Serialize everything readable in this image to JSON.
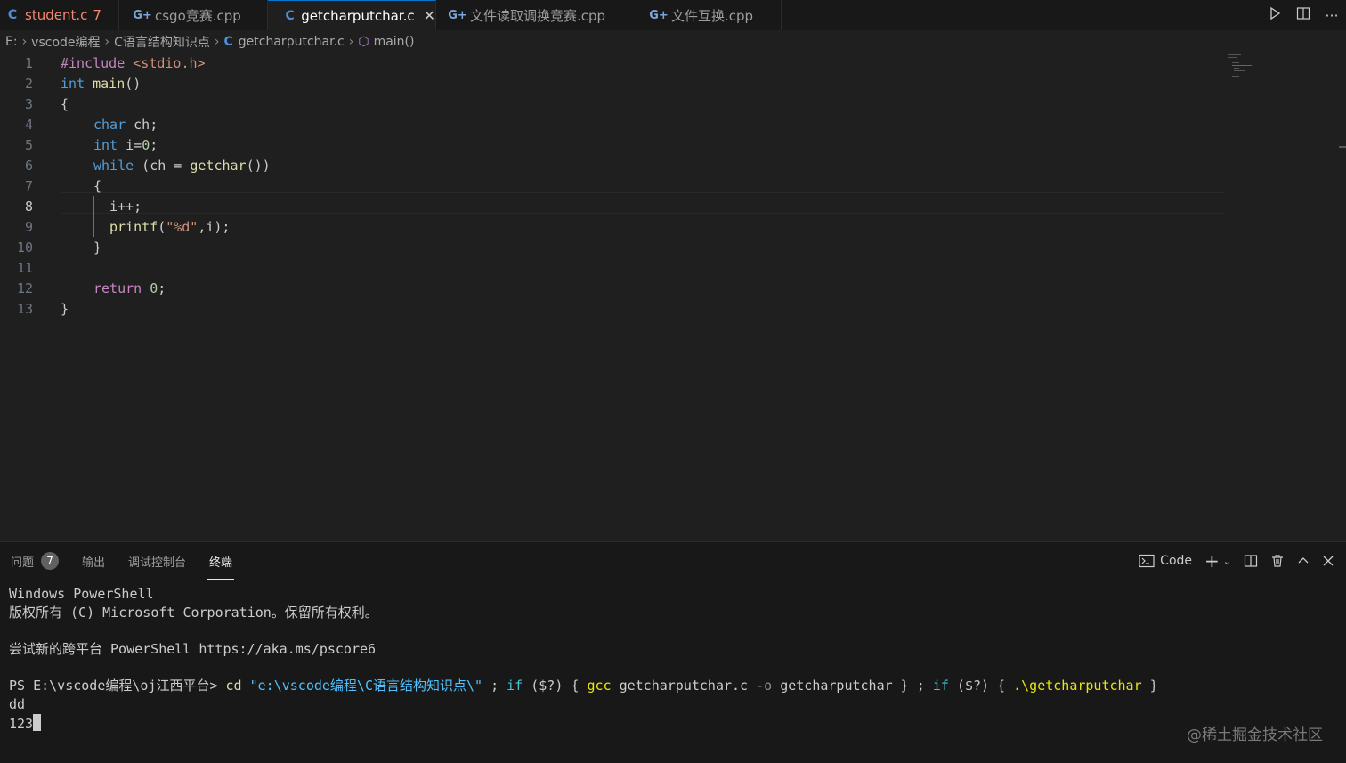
{
  "tabs": [
    {
      "name": "student.c",
      "badge": "7",
      "icon": "c-file-icon"
    },
    {
      "name": "csgo竞赛.cpp",
      "icon": "cpp-file-icon"
    },
    {
      "name": "getcharputchar.c",
      "icon": "c-file-icon",
      "active": true
    },
    {
      "name": "文件读取调换竞赛.cpp",
      "icon": "cpp-file-icon"
    },
    {
      "name": "文件互换.cpp",
      "icon": "cpp-file-icon"
    }
  ],
  "breadcrumb": {
    "drive": "E:",
    "folder1": "vscode编程",
    "folder2": "C语言结构知识点",
    "file": "getcharputchar.c",
    "symbol": "main()"
  },
  "editor": {
    "current_line": 8,
    "line_numbers": [
      "1",
      "2",
      "3",
      "4",
      "5",
      "6",
      "7",
      "8",
      "9",
      "10",
      "11",
      "12",
      "13"
    ],
    "tokens": {
      "include_kw": "#include",
      "include_header": "<stdio.h>",
      "int": "int",
      "main": "main",
      "parens": "()",
      "lbrace": "{",
      "rbrace": "}",
      "char": "char",
      "ch_decl": " ch;",
      "i_decl": " i=",
      "zero": "0",
      "semi": ";",
      "while": "while",
      "while_open": " (ch = ",
      "getchar": "getchar",
      "while_close": "())",
      "incr": "i++;",
      "printf": "printf",
      "printf_open": "(",
      "format_str": "\"%d\"",
      "printf_args": ",i);",
      "return": "return",
      "space": " "
    }
  },
  "panel": {
    "tabs": [
      "问题",
      "输出",
      "调试控制台",
      "终端"
    ],
    "problems_count": "7",
    "active_tab": "终端",
    "terminal_name": "Code",
    "terminal": {
      "line1": "Windows PowerShell",
      "line2": "版权所有 (C) Microsoft Corporation。保留所有权利。",
      "line3": "尝试新的跨平台 PowerShell https://aka.ms/pscore6",
      "prompt": "PS E:\\vscode编程\\oj江西平台> ",
      "cmd_cd": "cd",
      "cmd_path": "\"e:\\vscode编程\\C语言结构知识点\\\"",
      "cmd_sep1": " ; ",
      "cmd_if": "if",
      "cmd_cond": " ($?) { ",
      "cmd_gcc": "gcc",
      "cmd_gcc_args": " getcharputchar.c ",
      "cmd_o": "-o",
      "cmd_gcc_out": " getcharputchar } ; ",
      "cmd_if2": "if",
      "cmd_cond2": " ($?) { ",
      "cmd_run": ".\\getcharputchar",
      "cmd_end": " }",
      "out1": "dd",
      "out2": "123"
    }
  },
  "watermark": "@稀土掘金技术社区"
}
